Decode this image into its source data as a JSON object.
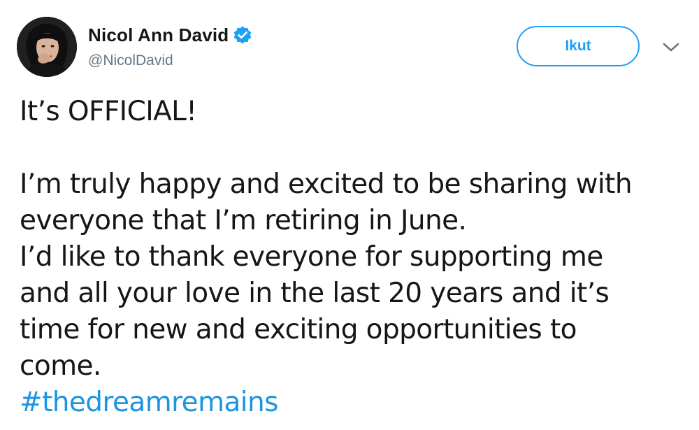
{
  "author": {
    "name": "Nicol Ann David",
    "handle": "@NicolDavid",
    "verified_icon": "verified-badge-icon"
  },
  "follow_button": {
    "label": "Ikut"
  },
  "menu": {
    "icon": "chevron-down-icon"
  },
  "tweet": {
    "headline": "It’s OFFICIAL!",
    "lines": [
      "I’m truly happy and excited to be sharing with",
      "everyone that I’m retiring in June.",
      "I’d like to thank everyone for supporting me",
      "and all your love in the last 20 years and it’s",
      "time for new and exciting opportunities to",
      "come."
    ],
    "hashtag": "#thedreamremains"
  },
  "colors": {
    "accent": "#1da1f2",
    "link": "#1b95e0",
    "text": "#14171a",
    "secondary": "#657786"
  }
}
